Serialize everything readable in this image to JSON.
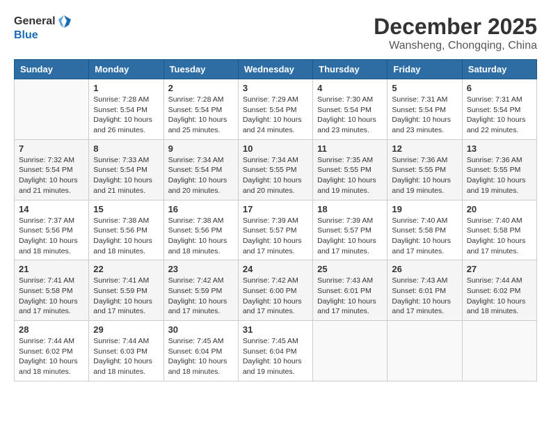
{
  "logo": {
    "text_general": "General",
    "text_blue": "Blue"
  },
  "title": "December 2025",
  "location": "Wansheng, Chongqing, China",
  "days_of_week": [
    "Sunday",
    "Monday",
    "Tuesday",
    "Wednesday",
    "Thursday",
    "Friday",
    "Saturday"
  ],
  "weeks": [
    [
      {
        "day": "",
        "info": ""
      },
      {
        "day": "1",
        "info": "Sunrise: 7:28 AM\nSunset: 5:54 PM\nDaylight: 10 hours\nand 26 minutes."
      },
      {
        "day": "2",
        "info": "Sunrise: 7:28 AM\nSunset: 5:54 PM\nDaylight: 10 hours\nand 25 minutes."
      },
      {
        "day": "3",
        "info": "Sunrise: 7:29 AM\nSunset: 5:54 PM\nDaylight: 10 hours\nand 24 minutes."
      },
      {
        "day": "4",
        "info": "Sunrise: 7:30 AM\nSunset: 5:54 PM\nDaylight: 10 hours\nand 23 minutes."
      },
      {
        "day": "5",
        "info": "Sunrise: 7:31 AM\nSunset: 5:54 PM\nDaylight: 10 hours\nand 23 minutes."
      },
      {
        "day": "6",
        "info": "Sunrise: 7:31 AM\nSunset: 5:54 PM\nDaylight: 10 hours\nand 22 minutes."
      }
    ],
    [
      {
        "day": "7",
        "info": "Sunrise: 7:32 AM\nSunset: 5:54 PM\nDaylight: 10 hours\nand 21 minutes."
      },
      {
        "day": "8",
        "info": "Sunrise: 7:33 AM\nSunset: 5:54 PM\nDaylight: 10 hours\nand 21 minutes."
      },
      {
        "day": "9",
        "info": "Sunrise: 7:34 AM\nSunset: 5:54 PM\nDaylight: 10 hours\nand 20 minutes."
      },
      {
        "day": "10",
        "info": "Sunrise: 7:34 AM\nSunset: 5:55 PM\nDaylight: 10 hours\nand 20 minutes."
      },
      {
        "day": "11",
        "info": "Sunrise: 7:35 AM\nSunset: 5:55 PM\nDaylight: 10 hours\nand 19 minutes."
      },
      {
        "day": "12",
        "info": "Sunrise: 7:36 AM\nSunset: 5:55 PM\nDaylight: 10 hours\nand 19 minutes."
      },
      {
        "day": "13",
        "info": "Sunrise: 7:36 AM\nSunset: 5:55 PM\nDaylight: 10 hours\nand 19 minutes."
      }
    ],
    [
      {
        "day": "14",
        "info": "Sunrise: 7:37 AM\nSunset: 5:56 PM\nDaylight: 10 hours\nand 18 minutes."
      },
      {
        "day": "15",
        "info": "Sunrise: 7:38 AM\nSunset: 5:56 PM\nDaylight: 10 hours\nand 18 minutes."
      },
      {
        "day": "16",
        "info": "Sunrise: 7:38 AM\nSunset: 5:56 PM\nDaylight: 10 hours\nand 18 minutes."
      },
      {
        "day": "17",
        "info": "Sunrise: 7:39 AM\nSunset: 5:57 PM\nDaylight: 10 hours\nand 17 minutes."
      },
      {
        "day": "18",
        "info": "Sunrise: 7:39 AM\nSunset: 5:57 PM\nDaylight: 10 hours\nand 17 minutes."
      },
      {
        "day": "19",
        "info": "Sunrise: 7:40 AM\nSunset: 5:58 PM\nDaylight: 10 hours\nand 17 minutes."
      },
      {
        "day": "20",
        "info": "Sunrise: 7:40 AM\nSunset: 5:58 PM\nDaylight: 10 hours\nand 17 minutes."
      }
    ],
    [
      {
        "day": "21",
        "info": "Sunrise: 7:41 AM\nSunset: 5:58 PM\nDaylight: 10 hours\nand 17 minutes."
      },
      {
        "day": "22",
        "info": "Sunrise: 7:41 AM\nSunset: 5:59 PM\nDaylight: 10 hours\nand 17 minutes."
      },
      {
        "day": "23",
        "info": "Sunrise: 7:42 AM\nSunset: 5:59 PM\nDaylight: 10 hours\nand 17 minutes."
      },
      {
        "day": "24",
        "info": "Sunrise: 7:42 AM\nSunset: 6:00 PM\nDaylight: 10 hours\nand 17 minutes."
      },
      {
        "day": "25",
        "info": "Sunrise: 7:43 AM\nSunset: 6:01 PM\nDaylight: 10 hours\nand 17 minutes."
      },
      {
        "day": "26",
        "info": "Sunrise: 7:43 AM\nSunset: 6:01 PM\nDaylight: 10 hours\nand 17 minutes."
      },
      {
        "day": "27",
        "info": "Sunrise: 7:44 AM\nSunset: 6:02 PM\nDaylight: 10 hours\nand 18 minutes."
      }
    ],
    [
      {
        "day": "28",
        "info": "Sunrise: 7:44 AM\nSunset: 6:02 PM\nDaylight: 10 hours\nand 18 minutes."
      },
      {
        "day": "29",
        "info": "Sunrise: 7:44 AM\nSunset: 6:03 PM\nDaylight: 10 hours\nand 18 minutes."
      },
      {
        "day": "30",
        "info": "Sunrise: 7:45 AM\nSunset: 6:04 PM\nDaylight: 10 hours\nand 18 minutes."
      },
      {
        "day": "31",
        "info": "Sunrise: 7:45 AM\nSunset: 6:04 PM\nDaylight: 10 hours\nand 19 minutes."
      },
      {
        "day": "",
        "info": ""
      },
      {
        "day": "",
        "info": ""
      },
      {
        "day": "",
        "info": ""
      }
    ]
  ]
}
